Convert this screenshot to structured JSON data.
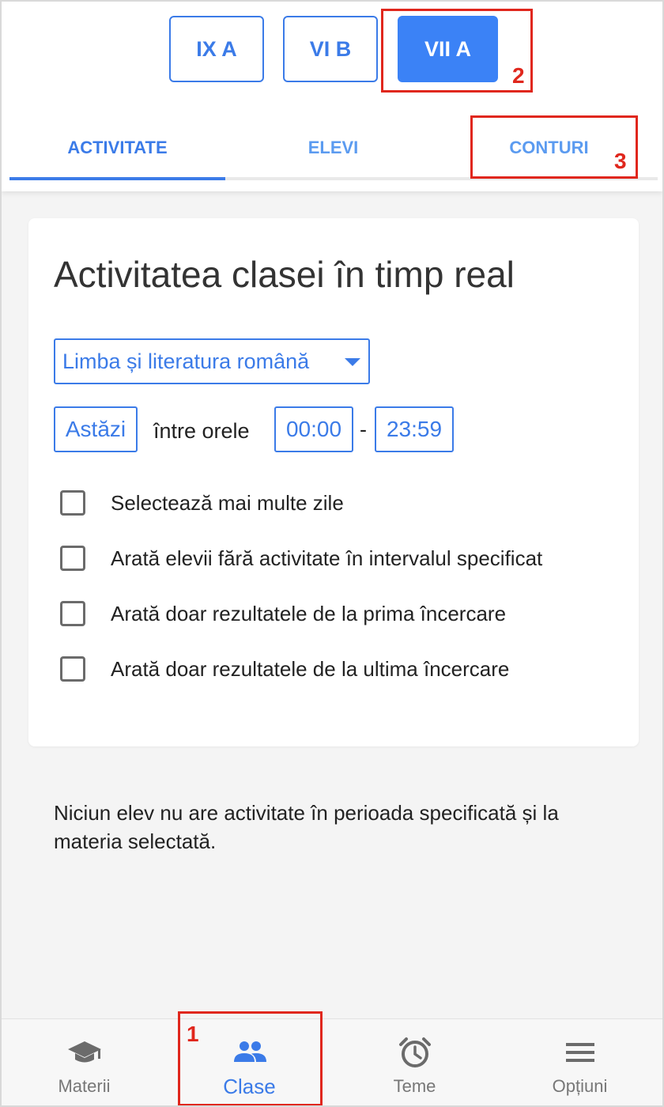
{
  "classes": [
    {
      "label": "IX A",
      "active": false
    },
    {
      "label": "VI B",
      "active": false
    },
    {
      "label": "VII A",
      "active": true
    }
  ],
  "tabs": [
    {
      "label": "ACTIVITATE",
      "active": true
    },
    {
      "label": "ELEVI",
      "active": false
    },
    {
      "label": "CONTURI",
      "active": false
    }
  ],
  "annotations": {
    "n1": "1",
    "n2": "2",
    "n3": "3",
    "color": "#e0271d"
  },
  "card": {
    "title": "Activitatea clasei în timp real",
    "subject_select": "Limba și literatura română",
    "date_button": "Astăzi",
    "between_label": "între orele",
    "time_from": "00:00",
    "time_separator": "-",
    "time_to": "23:59",
    "options": [
      {
        "label": "Selectează mai multe zile",
        "checked": false
      },
      {
        "label": "Arată elevii fără activitate în intervalul specificat",
        "checked": false
      },
      {
        "label": "Arată doar rezultatele de la prima încercare",
        "checked": false
      },
      {
        "label": "Arată doar rezultatele de la ultima încercare",
        "checked": false
      }
    ]
  },
  "empty_message": "Niciun elev nu are activitate în perioada specificată și la materia selectată.",
  "bottom_nav": [
    {
      "label": "Materii",
      "icon": "graduation-cap-icon",
      "active": false
    },
    {
      "label": "Clase",
      "icon": "group-icon",
      "active": true
    },
    {
      "label": "Teme",
      "icon": "alarm-clock-icon",
      "active": false
    },
    {
      "label": "Opțiuni",
      "icon": "menu-icon",
      "active": false
    }
  ],
  "colors": {
    "accent": "#3b7be8",
    "active_button": "#3b82f6",
    "annotation": "#e0271d"
  }
}
